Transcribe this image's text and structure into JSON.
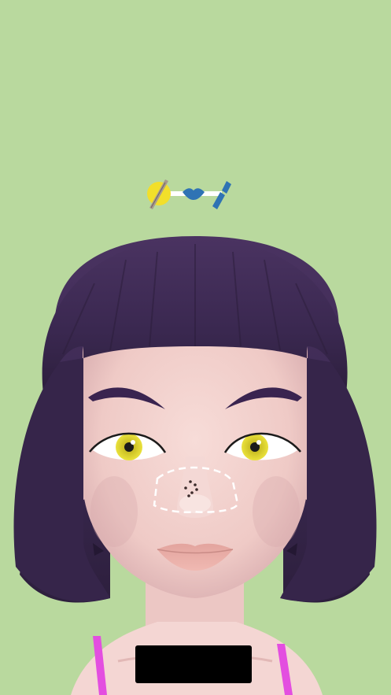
{
  "game": {
    "background_color": "#b9d99e",
    "progress": {
      "steps": [
        {
          "name": "tweezers",
          "icon": "tweezers-icon",
          "state": "active"
        },
        {
          "name": "lips",
          "icon": "lips-icon",
          "state": "pending"
        },
        {
          "name": "lipstick",
          "icon": "lipstick-icon",
          "state": "pending"
        }
      ],
      "active_color": "#f2df2a",
      "pending_color": "#2f73b4",
      "connector_color": "#ffffff"
    },
    "character": {
      "hair_color": "#3e2a52",
      "skin_color": "#f1d1cd",
      "eye_color": "#e0d52a",
      "lip_color": "#e8a9a2",
      "top_strap_color": "#e34ee0"
    },
    "target_zone": {
      "area": "nose",
      "outline_color": "#ffffff",
      "blackheads_count": 6
    },
    "bottom_panel_color": "#000000"
  }
}
